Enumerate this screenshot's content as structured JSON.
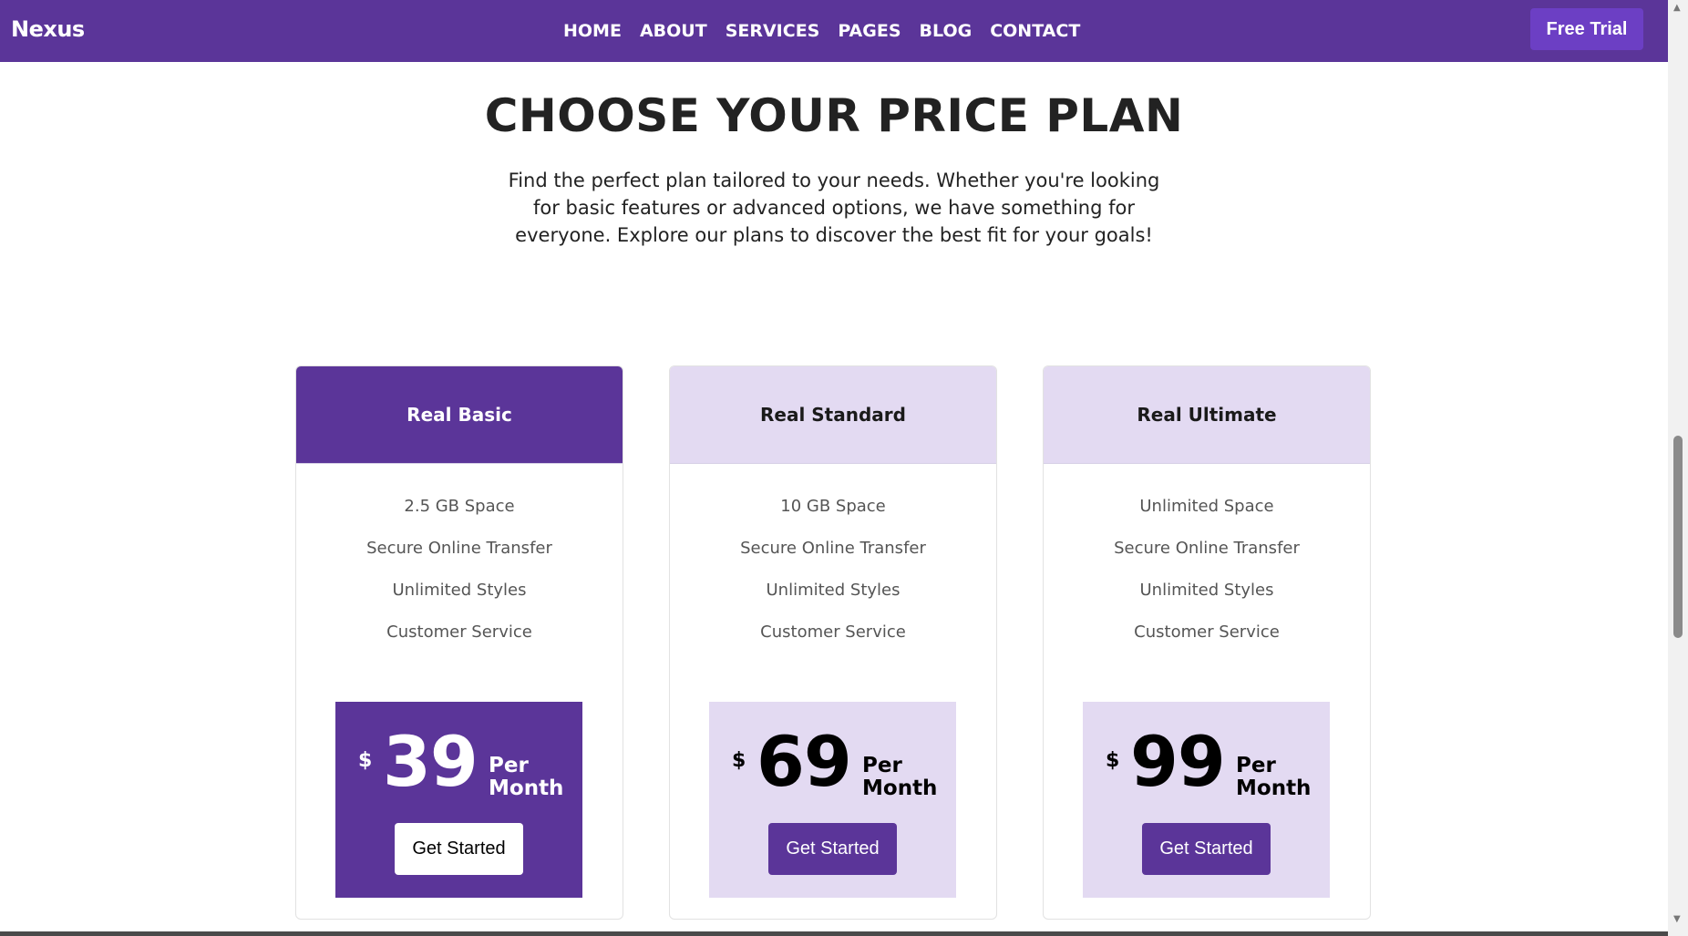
{
  "nav": {
    "brand": "Nexus",
    "links": [
      "HOME",
      "ABOUT",
      "SERVICES",
      "PAGES",
      "BLOG",
      "CONTACT"
    ],
    "cta": "Free Trial"
  },
  "hero": {
    "title": "CHOOSE YOUR PRICE PLAN",
    "intro": "Find the perfect plan tailored to your needs. Whether you're looking for basic features or advanced options, we have something for everyone. Explore our plans to discover the best fit for your goals!"
  },
  "plans": [
    {
      "name": "Real Basic",
      "features": [
        "2.5 GB Space",
        "Secure Online Transfer",
        "Unlimited Styles",
        "Customer Service"
      ],
      "currency": "$",
      "price": "39",
      "per": "Per",
      "period": "Month",
      "button": "Get Started"
    },
    {
      "name": "Real Standard",
      "features": [
        "10 GB Space",
        "Secure Online Transfer",
        "Unlimited Styles",
        "Customer Service"
      ],
      "currency": "$",
      "price": "69",
      "per": "Per",
      "period": "Month",
      "button": "Get Started"
    },
    {
      "name": "Real Ultimate",
      "features": [
        "Unlimited Space",
        "Secure Online Transfer",
        "Unlimited Styles",
        "Customer Service"
      ],
      "currency": "$",
      "price": "99",
      "per": "Per",
      "period": "Month",
      "button": "Get Started"
    }
  ],
  "colors": {
    "primary": "#5b3599",
    "accent": "#6c3fc4",
    "light": "#e3daf2"
  }
}
